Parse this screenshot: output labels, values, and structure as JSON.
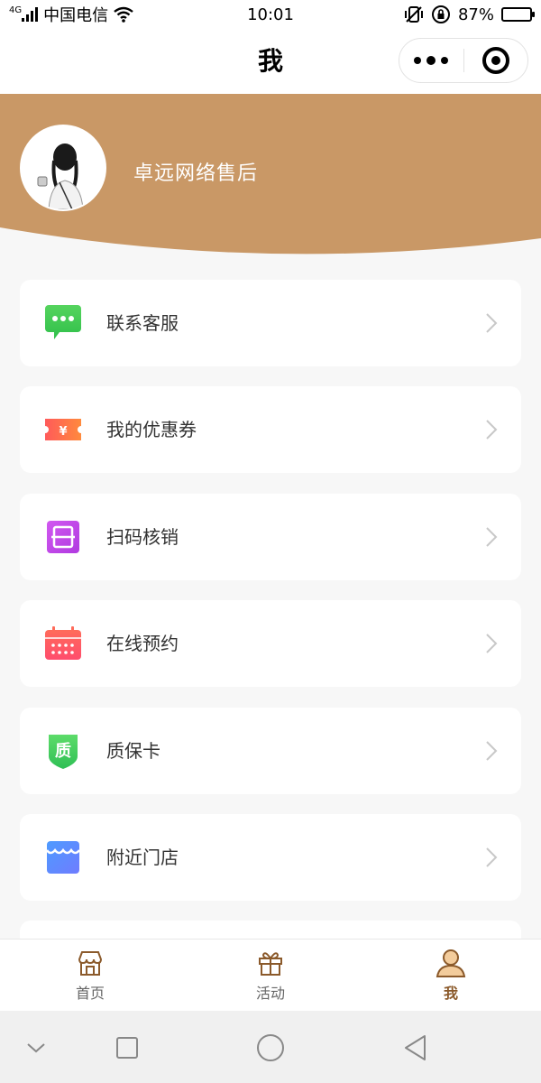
{
  "status_bar": {
    "network": "4G",
    "carrier": "中国电信",
    "time": "10:01",
    "battery": "87%",
    "battery_level": 0.87
  },
  "nav": {
    "title": "我"
  },
  "profile": {
    "username": "卓远网络售后",
    "banner_color": "#c99866"
  },
  "menu": [
    {
      "label": "联系客服",
      "icon": "chat-icon"
    },
    {
      "label": "我的优惠券",
      "icon": "coupon-icon"
    },
    {
      "label": "扫码核销",
      "icon": "scan-icon"
    },
    {
      "label": "在线预约",
      "icon": "calendar-icon"
    },
    {
      "label": "质保卡",
      "icon": "warranty-icon"
    },
    {
      "label": "附近门店",
      "icon": "store-icon"
    }
  ],
  "tabbar": {
    "tabs": [
      {
        "label": "首页",
        "icon": "home-store-icon"
      },
      {
        "label": "活动",
        "icon": "gift-icon"
      },
      {
        "label": "我",
        "icon": "user-icon",
        "active": true
      }
    ],
    "active_color": "#8b5a2b"
  },
  "warranty_glyph": "质",
  "coupon_glyph": "¥"
}
